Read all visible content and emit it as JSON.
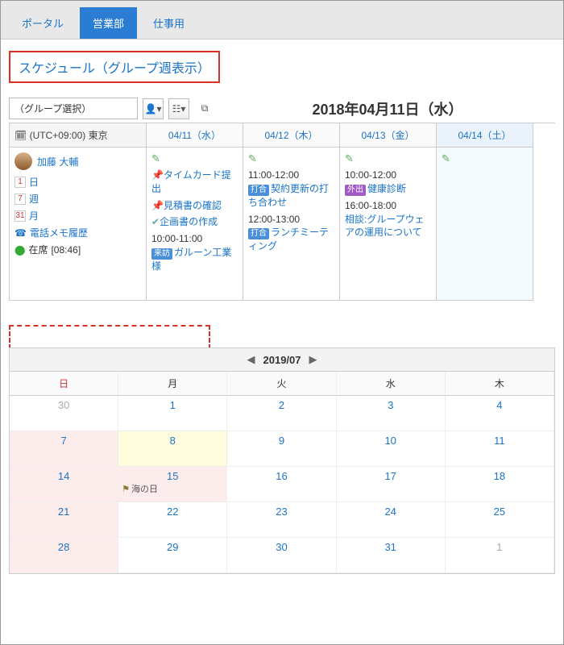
{
  "tabs": {
    "portal": "ポータル",
    "sales": "営業部",
    "work": "仕事用"
  },
  "title": "スケジュール（グループ週表示）",
  "group_select_placeholder": "（グループ選択）",
  "date_title": "2018年04月11日（水）",
  "timezone": "(UTC+09:00) 東京",
  "week_headers": {
    "d1": "04/11（水）",
    "d2": "04/12（木）",
    "d3": "04/13（金）",
    "d4": "04/14（土）"
  },
  "person": {
    "name": "加藤 大輔"
  },
  "sidebar": {
    "day": "日",
    "week": "週",
    "month": "月",
    "phone_memo": "電話メモ履歴",
    "presence_label": "在席",
    "presence_time": "[08:46]"
  },
  "col1": {
    "timecard": "タイムカード提出",
    "estimate": "見積書の確認",
    "plan": "企画書の作成",
    "ev1_time": "10:00-11:00",
    "ev1_tag": "来訪",
    "ev1_text": "ガルーン工業様"
  },
  "col2": {
    "ev1_time": "11:00-12:00",
    "ev1_tag": "打合",
    "ev1_text": "契約更新の打ち合わせ",
    "ev2_time": "12:00-13:00",
    "ev2_tag": "打合",
    "ev2_text": "ランチミーティング"
  },
  "col3": {
    "ev1_time": "10:00-12:00",
    "ev1_tag": "外出",
    "ev1_text": "健康診断",
    "ev2_time": "16:00-18:00",
    "ev2_text": "相談:グループウェアの運用について"
  },
  "month": {
    "label": "2019/07",
    "headers": {
      "sun": "日",
      "mon": "月",
      "tue": "火",
      "wed": "水",
      "thu": "木"
    },
    "holiday_name": "海の日",
    "cells": {
      "c0": "30",
      "c1": "1",
      "c2": "2",
      "c3": "3",
      "c4": "4",
      "c5": "7",
      "c6": "8",
      "c7": "9",
      "c8": "10",
      "c9": "11",
      "c10": "14",
      "c11": "15",
      "c12": "16",
      "c13": "17",
      "c14": "18",
      "c15": "21",
      "c16": "22",
      "c17": "23",
      "c18": "24",
      "c19": "25",
      "c20": "28",
      "c21": "29",
      "c22": "30",
      "c23": "31",
      "c24": "1"
    }
  }
}
